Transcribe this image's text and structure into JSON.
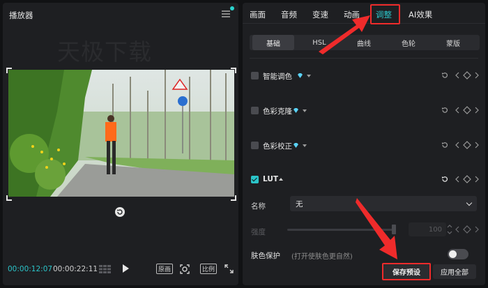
{
  "player": {
    "title": "播放器",
    "watermark": "天极下载",
    "timecode_current": "00:00:12:07",
    "timecode_total": "00:00:22:11",
    "original_label": "原画",
    "ratio_label": "比例"
  },
  "panel": {
    "tabs": [
      {
        "label": "画面"
      },
      {
        "label": "音频"
      },
      {
        "label": "变速"
      },
      {
        "label": "动画"
      },
      {
        "label": "调整",
        "active": true
      },
      {
        "label": "AI效果"
      }
    ],
    "subtabs": [
      {
        "label": "基础",
        "active": true
      },
      {
        "label": "HSL"
      },
      {
        "label": "曲线"
      },
      {
        "label": "色轮"
      },
      {
        "label": "蒙版"
      }
    ],
    "rows": [
      {
        "label": "智能调色",
        "checked": false,
        "premium": true
      },
      {
        "label": "色彩克隆",
        "checked": false,
        "premium": true
      },
      {
        "label": "色彩校正",
        "checked": false,
        "premium": true
      },
      {
        "label": "LUT",
        "checked": true,
        "premium": false
      }
    ],
    "lut": {
      "name_label": "名称",
      "name_value": "无",
      "strength_label": "强度",
      "strength_value": "100",
      "strength_level": 1.0
    },
    "skin": {
      "label": "肤色保护",
      "hint": "(打开使肤色更自然)",
      "enabled": false
    },
    "buttons": {
      "save_preset": "保存预设",
      "apply_all": "应用全部"
    }
  },
  "colors": {
    "accent": "#2bc4c9",
    "highlight": "#ef2b2b",
    "premium": "#5ad2f5"
  }
}
